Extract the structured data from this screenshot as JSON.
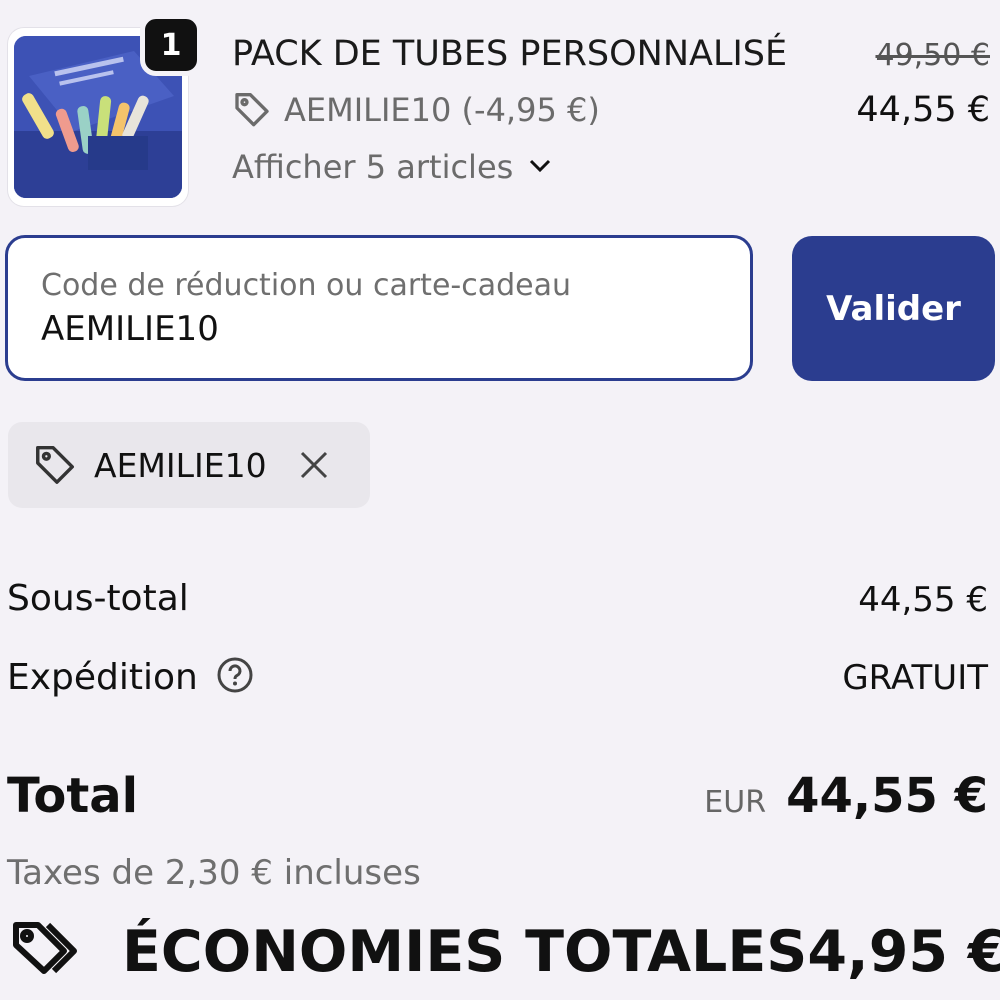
{
  "product": {
    "quantity": "1",
    "title": "PACK DE TUBES PERSONNALISÉ",
    "discount_text": "AEMILIE10 (-4,95 €)",
    "show_items_label": "Afficher 5 articles",
    "original_price": "49,50 €",
    "price": "44,55 €",
    "image_icon": "product-photo"
  },
  "discount_field": {
    "label": "Code de réduction ou carte-cadeau",
    "value": "AEMILIE10",
    "button_label": "Valider"
  },
  "applied_code": {
    "code": "AEMILIE10",
    "remove_icon": "close-icon"
  },
  "summary": {
    "subtotal_label": "Sous-total",
    "subtotal_value": "44,55 €",
    "shipping_label": "Expédition",
    "shipping_value": "GRATUIT",
    "total_label": "Total",
    "currency": "EUR",
    "total_value": "44,55 €",
    "taxes_text": "Taxes de 2,30 € incluses",
    "savings_label": "ÉCONOMIES TOTALES",
    "savings_value": "4,95 €"
  },
  "colors": {
    "background": "#f4f2f7",
    "accent": "#2b3d8f",
    "muted_text": "#6f6f6f"
  }
}
